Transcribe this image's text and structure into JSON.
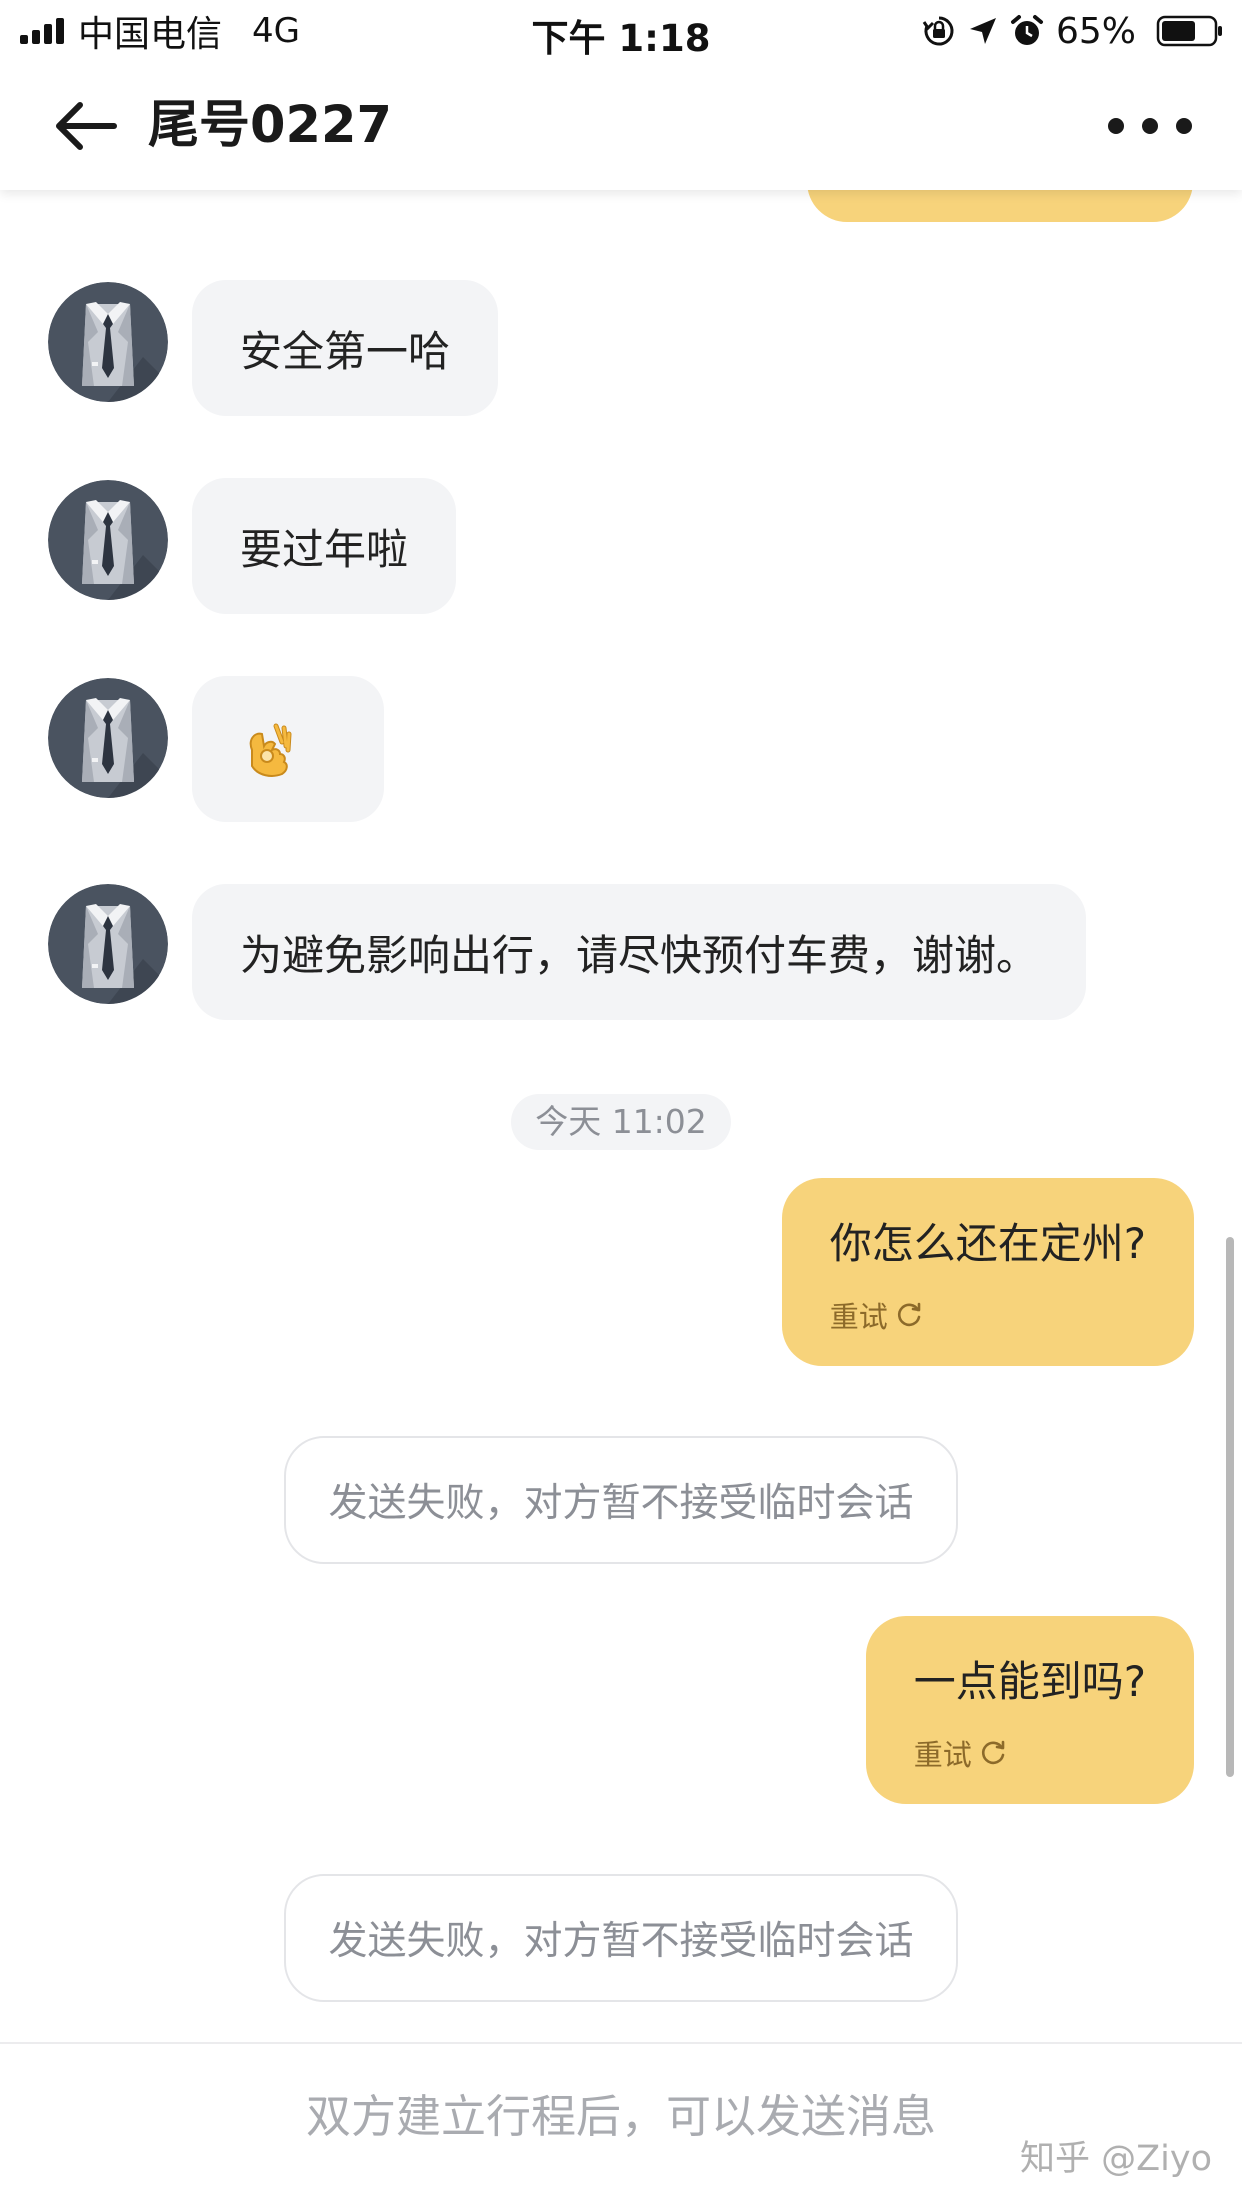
{
  "status_bar": {
    "carrier": "中国电信",
    "network": "4G",
    "time": "下午 1:18",
    "battery": "65%",
    "battery_level": 0.65,
    "icons": [
      "signal-icon",
      "rotation-lock-icon",
      "location-arrow-icon",
      "alarm-icon",
      "battery-icon"
    ]
  },
  "nav": {
    "title": "尾号0227",
    "back_icon": "back-arrow-icon",
    "more_icon": "more-icon"
  },
  "messages": {
    "in_1": "安全第一哈",
    "in_2": "要过年啦",
    "in_3_emoji": "ok-hand-emoji",
    "in_4": "为避免影响出行，请尽快预付车费，谢谢。",
    "timestamp": "今天 11:02",
    "out_1": "你怎么还在定州?",
    "out_1_retry": "重试",
    "notice_1": "发送失败，对方暂不接受临时会话",
    "out_2": "一点能到吗?",
    "out_2_retry": "重试",
    "notice_2": "发送失败，对方暂不接受临时会话"
  },
  "input": {
    "placeholder": "双方建立行程后，可以发送消息"
  },
  "watermark": "知乎 @Ziyo",
  "colors": {
    "outgoing_bubble": "#f7d37b",
    "incoming_bubble": "#f3f4f6",
    "avatar_bg": "#4a5360"
  }
}
